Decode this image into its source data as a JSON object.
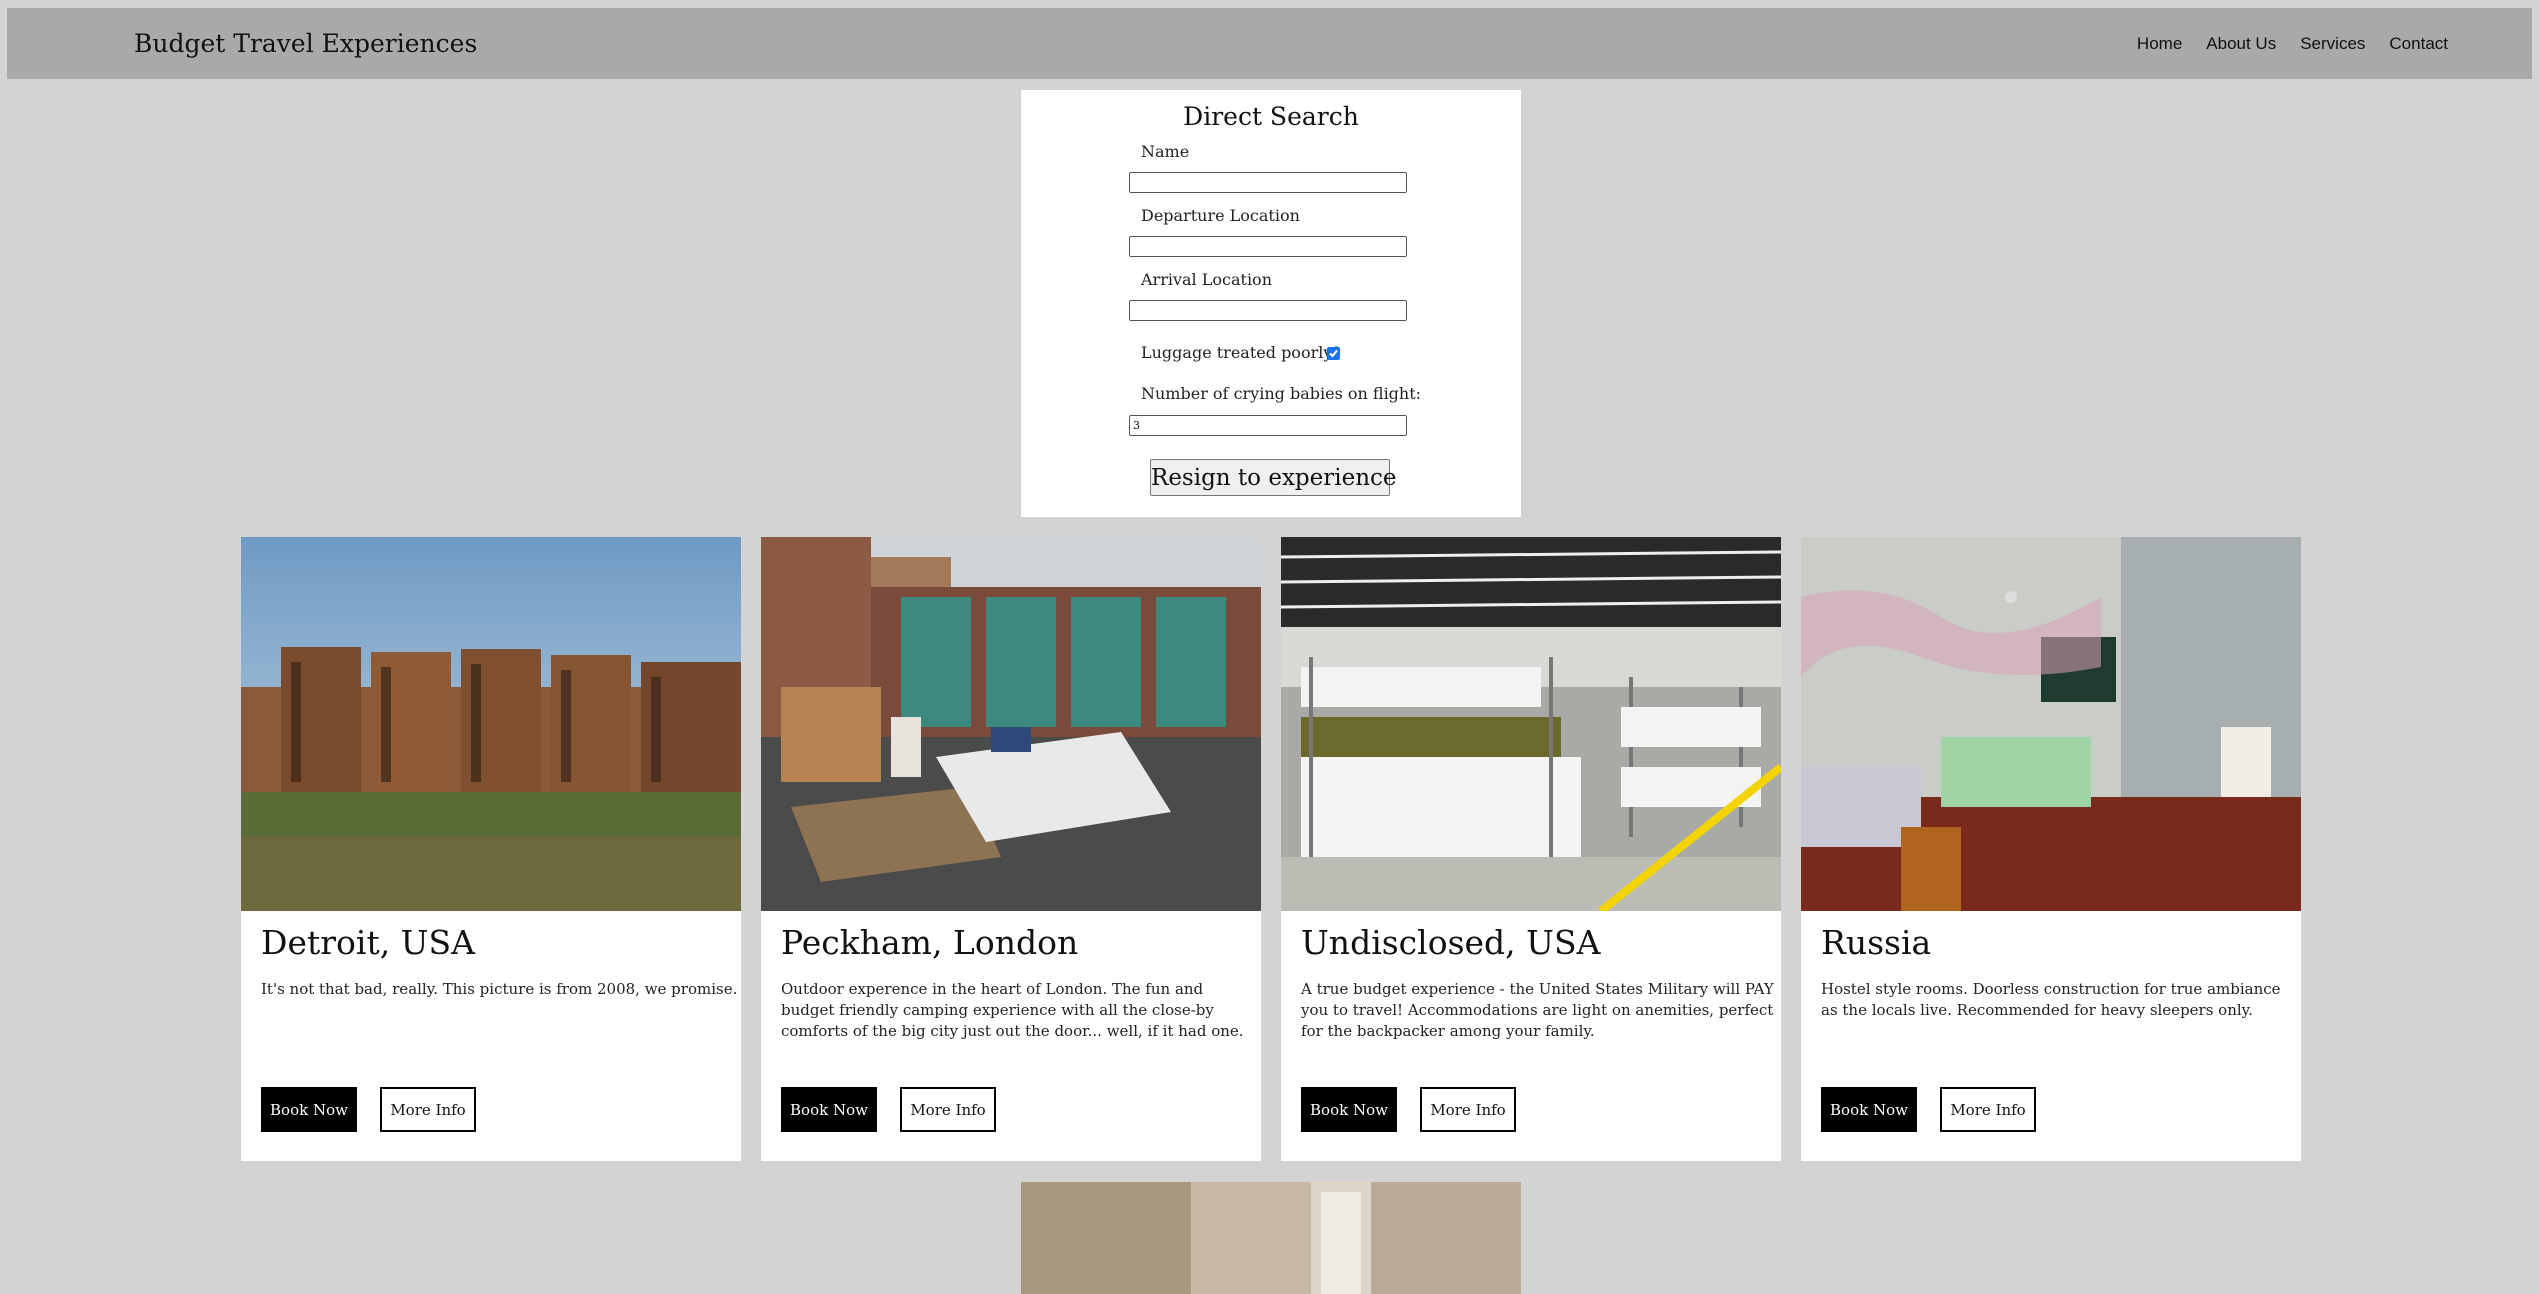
{
  "navbar": {
    "brand": "Budget Travel Experiences",
    "links": [
      "Home",
      "About Us",
      "Services",
      "Contact"
    ]
  },
  "search": {
    "title": "Direct Search",
    "name_label": "Name",
    "departure_label": "Departure Location",
    "arrival_label": "Arrival Location",
    "luggage_label": "Luggage treated poorly?",
    "luggage_checked": true,
    "babies_label": "Number of crying babies on flight:",
    "babies_value": "3",
    "submit_label": "Resign to experience"
  },
  "cards": [
    {
      "title": "Detroit, USA",
      "description": "It's not that bad, really. This picture is from 2008, we promise.",
      "book_label": "Book Now",
      "info_label": "More Info",
      "image": "abandoned-brick-apartment-buildings"
    },
    {
      "title": "Peckham, London",
      "description": "Outdoor experence in the heart of London. The fun and budget friendly camping experience with all the close-by comforts of the big city just out the door... well, if it had one.",
      "book_label": "Book Now",
      "info_label": "More Info",
      "image": "bed-in-garage-lot"
    },
    {
      "title": "Undisclosed, USA",
      "description": "A true budget experience - the United States Military will PAY you to travel! Accommodations are light on anemities, perfect for the backpacker among your family.",
      "book_label": "Book Now",
      "info_label": "More Info",
      "image": "military-bunk-beds-warehouse"
    },
    {
      "title": "Russia",
      "description": "Hostel style rooms. Doorless construction for true ambiance as the locals live. Recommended for heavy sleepers only.",
      "book_label": "Book Now",
      "info_label": "More Info",
      "image": "dilapidated-room-with-beds"
    }
  ],
  "bottom_card": {
    "image": "interior-room-with-door"
  }
}
